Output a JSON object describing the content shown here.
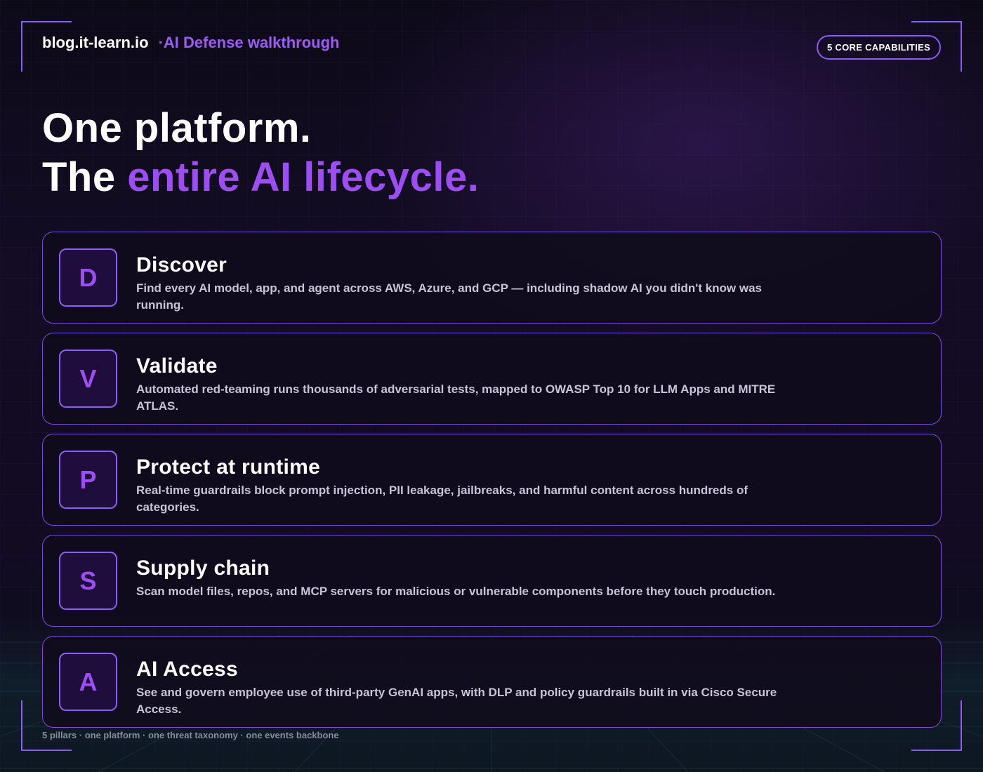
{
  "header": {
    "site_name": "blog.it-learn.io",
    "subtitle": "·AI Defense walkthrough"
  },
  "badge": {
    "label": "5 CORE CAPABILITIES"
  },
  "hero": {
    "line1": "One platform.",
    "line2_prefix": "The ",
    "line2_accent": "entire AI lifecycle."
  },
  "capabilities": [
    {
      "letter": "D",
      "title": "Discover",
      "description": "Find every AI model, app, and agent across AWS, Azure, and GCP — including shadow AI you didn't know was running."
    },
    {
      "letter": "V",
      "title": "Validate",
      "description": "Automated red-teaming runs thousands of adversarial tests, mapped to OWASP Top 10 for LLM Apps and MITRE ATLAS."
    },
    {
      "letter": "P",
      "title": "Protect at runtime",
      "description": "Real-time guardrails block prompt injection, PII leakage, jailbreaks, and harmful content across hundreds of categories."
    },
    {
      "letter": "S",
      "title": "Supply chain",
      "description": "Scan model files, repos, and MCP servers for malicious or vulnerable components before they touch production."
    },
    {
      "letter": "A",
      "title": "AI Access",
      "description": "See and govern employee use of third-party GenAI apps, with DLP and policy guardrails built in via Cisco Secure Access."
    }
  ],
  "footer": {
    "text": "5 pillars · one platform · one threat taxonomy · one events backbone"
  },
  "colors": {
    "accent": "#9d4ef2",
    "border": "#8b5cf6",
    "background": "#130c24"
  }
}
